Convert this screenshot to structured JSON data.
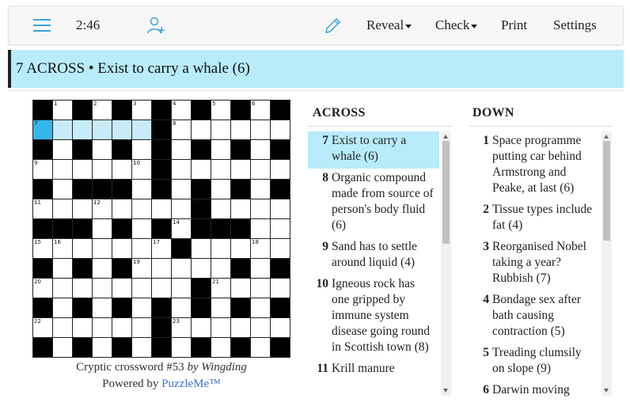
{
  "toolbar": {
    "menu_icon": "hamburger-menu-icon",
    "timer": "2:46",
    "add_user_icon": "add-user-icon",
    "pencil_icon": "pencil-icon",
    "reveal": "Reveal",
    "check": "Check",
    "print": "Print",
    "settings": "Settings"
  },
  "current_clue": "7 ACROSS • Exist to carry a whale (6)",
  "puzzle": {
    "title": "Cryptic crossword #53",
    "by": "by Wingding",
    "powered_prefix": "Powered by",
    "powered_link": "PuzzleMe™",
    "size": 13,
    "rows": [
      "#.#.#.#.#.#.#",
      "......#......",
      "#.#.#.#.#.#.#",
      "......#......",
      "#.###.#.#.#.#",
      "........#....",
      "###.#.#.###..",
      ".......#.....",
      "#.#.#.....#.#",
      "........#....",
      "#.#.#.#.#.#.#",
      "......#......",
      "#.#.#.#.#.#.#"
    ],
    "numbers": [
      {
        "r": 0,
        "c": 1,
        "n": "1"
      },
      {
        "r": 0,
        "c": 3,
        "n": "2"
      },
      {
        "r": 0,
        "c": 5,
        "n": "3"
      },
      {
        "r": 0,
        "c": 7,
        "n": "4"
      },
      {
        "r": 0,
        "c": 9,
        "n": "5"
      },
      {
        "r": 0,
        "c": 11,
        "n": "6"
      },
      {
        "r": 1,
        "c": 0,
        "n": "7"
      },
      {
        "r": 1,
        "c": 7,
        "n": "8"
      },
      {
        "r": 3,
        "c": 0,
        "n": "9"
      },
      {
        "r": 3,
        "c": 5,
        "n": "10"
      },
      {
        "r": 5,
        "c": 0,
        "n": "11"
      },
      {
        "r": 5,
        "c": 3,
        "n": "12"
      },
      {
        "r": 5,
        "c": 8,
        "n": "13"
      },
      {
        "r": 6,
        "c": 7,
        "n": "14"
      },
      {
        "r": 7,
        "c": 0,
        "n": "15"
      },
      {
        "r": 7,
        "c": 1,
        "n": "16"
      },
      {
        "r": 7,
        "c": 6,
        "n": "17"
      },
      {
        "r": 7,
        "c": 11,
        "n": "18"
      },
      {
        "r": 8,
        "c": 5,
        "n": "19"
      },
      {
        "r": 9,
        "c": 0,
        "n": "20"
      },
      {
        "r": 9,
        "c": 9,
        "n": "21"
      },
      {
        "r": 11,
        "c": 0,
        "n": "22"
      },
      {
        "r": 11,
        "c": 7,
        "n": "23"
      }
    ],
    "current": {
      "r": 1,
      "c": 0
    },
    "highlight": [
      {
        "r": 1,
        "c": 1
      },
      {
        "r": 1,
        "c": 2
      },
      {
        "r": 1,
        "c": 3
      },
      {
        "r": 1,
        "c": 4
      },
      {
        "r": 1,
        "c": 5
      }
    ]
  },
  "across": {
    "heading": "ACROSS",
    "clues": [
      {
        "num": "7",
        "text": "Exist to carry a whale (6)",
        "active": true
      },
      {
        "num": "8",
        "text": "Organic compound made from source of person's body fluid (6)",
        "active": false
      },
      {
        "num": "9",
        "text": "Sand has to settle around liquid (4)",
        "active": false
      },
      {
        "num": "10",
        "text": "Igneous rock has one gripped by immune system disease going round in Scottish town (8)",
        "active": false
      },
      {
        "num": "11",
        "text": "Krill manure",
        "active": false
      }
    ],
    "scroll_fraction": 0.0
  },
  "down": {
    "heading": "DOWN",
    "clues": [
      {
        "num": "1",
        "text": "Space programme putting car behind Armstrong and Peake, at last (6)",
        "active": false
      },
      {
        "num": "2",
        "text": "Tissue types include fat (4)",
        "active": false
      },
      {
        "num": "3",
        "text": "Reorganised Nobel taking a year? Rubbish (7)",
        "active": false
      },
      {
        "num": "4",
        "text": "Bondage sex after bath causing contraction (5)",
        "active": false
      },
      {
        "num": "5",
        "text": "Treading clumsily on slope (9)",
        "active": false
      },
      {
        "num": "6",
        "text": "Darwin moving",
        "active": false
      }
    ],
    "scroll_fraction": 0.0
  },
  "colors": {
    "accent": "#3aa6d8",
    "clue_highlight": "#b8ecfa",
    "current_cell": "#35b6ea",
    "word_cells": "#c7ebf9"
  }
}
